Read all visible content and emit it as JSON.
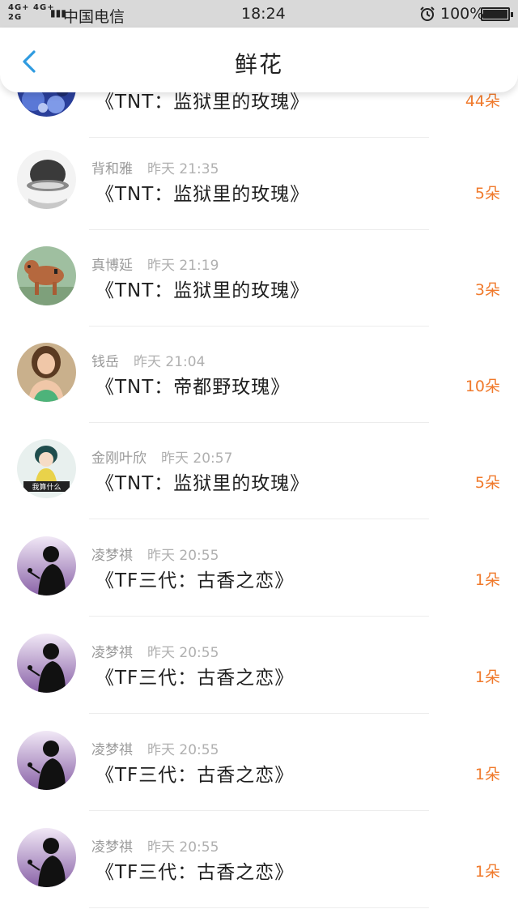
{
  "status_bar": {
    "signal": "4G+ 4G+\n2G",
    "carrier": "中国电信",
    "time": "18:24",
    "battery_pct": "100%"
  },
  "nav": {
    "title": "鲜花"
  },
  "colors": {
    "accent_blue": "#2f9be0",
    "quantity_orange": "#f07a2c"
  },
  "rows": [
    {
      "user": "",
      "time": "",
      "gift": "《TNT：监狱里的玫瑰》",
      "qty": "44朵",
      "avatar": "avatar-blue-pattern"
    },
    {
      "user": "背和雅",
      "time": "昨天 21:35",
      "gift": "《TNT：监狱里的玫瑰》",
      "qty": "5朵",
      "avatar": "avatar-gray-hat"
    },
    {
      "user": "真博延",
      "time": "昨天 21:19",
      "gift": "《TNT：监狱里的玫瑰》",
      "qty": "3朵",
      "avatar": "avatar-dog"
    },
    {
      "user": "钱岳",
      "time": "昨天 21:04",
      "gift": "《TNT：帝都野玫瑰》",
      "qty": "10朵",
      "avatar": "avatar-woman"
    },
    {
      "user": "金刚叶欣",
      "time": "昨天 20:57",
      "gift": "《TNT：监狱里的玫瑰》",
      "qty": "5朵",
      "avatar": "avatar-cartoon",
      "avatar_caption": "我算什么"
    },
    {
      "user": "凌梦祺",
      "time": "昨天 20:55",
      "gift": "《TF三代：古香之恋》",
      "qty": "1朵",
      "avatar": "avatar-silhouette"
    },
    {
      "user": "凌梦祺",
      "time": "昨天 20:55",
      "gift": "《TF三代：古香之恋》",
      "qty": "1朵",
      "avatar": "avatar-silhouette"
    },
    {
      "user": "凌梦祺",
      "time": "昨天 20:55",
      "gift": "《TF三代：古香之恋》",
      "qty": "1朵",
      "avatar": "avatar-silhouette"
    },
    {
      "user": "凌梦祺",
      "time": "昨天 20:55",
      "gift": "《TF三代：古香之恋》",
      "qty": "1朵",
      "avatar": "avatar-silhouette"
    }
  ]
}
